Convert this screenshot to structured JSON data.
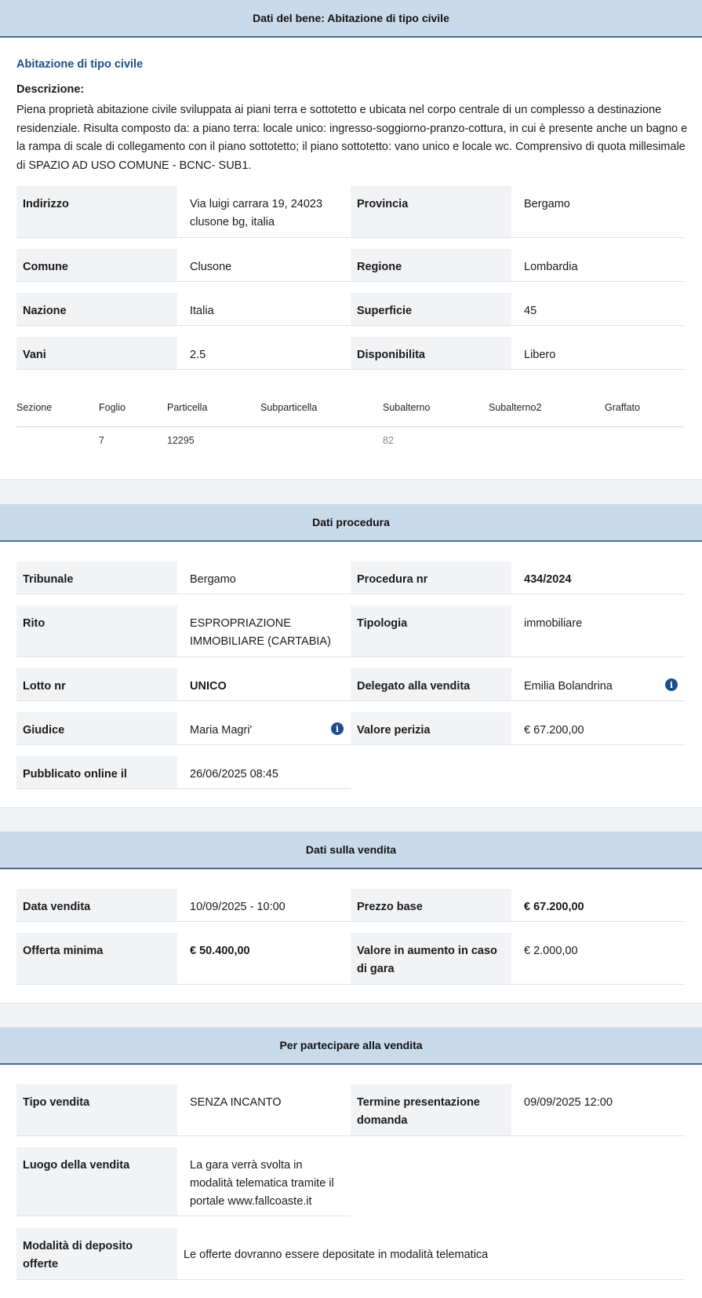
{
  "sections": {
    "bene": "Dati del bene: Abitazione di tipo civile",
    "procedura": "Dati procedura",
    "vendita": "Dati sulla vendita",
    "partecipare": "Per partecipare alla vendita"
  },
  "bene": {
    "subtitle": "Abitazione di tipo civile",
    "desc_label": "Descrizione:",
    "description": "Piena proprietà abitazione civile sviluppata ai piani terra e sottotetto e ubicata nel corpo centrale di un complesso a destinazione residenziale. Risulta composto da: a piano terra: locale unico: ingresso-soggiorno-pranzo-cottura, in cui è presente anche un bagno e la rampa di scale di collegamento con il piano sottotetto; il piano sottotetto: vano unico e locale wc. Comprensivo di quota millesimale di SPAZIO AD USO COMUNE - BCNC- SUB1.",
    "indirizzo_l": "Indirizzo",
    "indirizzo_v": "Via luigi carrara 19, 24023 clusone bg, italia",
    "provincia_l": "Provincia",
    "provincia_v": "Bergamo",
    "comune_l": "Comune",
    "comune_v": "Clusone",
    "regione_l": "Regione",
    "regione_v": "Lombardia",
    "nazione_l": "Nazione",
    "nazione_v": "Italia",
    "superficie_l": "Superficie",
    "superficie_v": "45",
    "vani_l": "Vani",
    "vani_v": "2.5",
    "disponibilita_l": "Disponibilita",
    "disponibilita_v": "Libero"
  },
  "catasto": {
    "headers": [
      "Sezione",
      "Foglio",
      "Particella",
      "Subparticella",
      "Subalterno",
      "Subalterno2",
      "Graffato"
    ],
    "row": [
      "",
      "7",
      "12295",
      "",
      "82",
      "",
      ""
    ]
  },
  "procedura": {
    "tribunale_l": "Tribunale",
    "tribunale_v": "Bergamo",
    "procedura_l": "Procedura nr",
    "procedura_v": "434/2024",
    "rito_l": "Rito",
    "rito_v": "ESPROPRIAZIONE IMMOBILIARE (CARTABIA)",
    "tipologia_l": "Tipologia",
    "tipologia_v": "immobiliare",
    "lotto_l": "Lotto nr",
    "lotto_v": "UNICO",
    "delegato_l": "Delegato alla vendita",
    "delegato_v": "Emilia Bolandrina",
    "giudice_l": "Giudice",
    "giudice_v": "Maria Magri'",
    "perizia_l": "Valore perizia",
    "perizia_v": "€ 67.200,00",
    "pubblicato_l": "Pubblicato online il",
    "pubblicato_v": "26/06/2025 08:45"
  },
  "vendita": {
    "data_l": "Data vendita",
    "data_v": "10/09/2025 - 10:00",
    "prezzo_l": "Prezzo base",
    "prezzo_v": "€ 67.200,00",
    "offerta_l": "Offerta minima",
    "offerta_v": "€ 50.400,00",
    "aumento_l": "Valore in aumento in caso di gara",
    "aumento_v": "€ 2.000,00"
  },
  "partecipare": {
    "tipo_l": "Tipo vendita",
    "tipo_v": "SENZA INCANTO",
    "termine_l": "Termine presentazione domanda",
    "termine_v": "09/09/2025 12:00",
    "luogo_l": "Luogo della vendita",
    "luogo_v": "La gara verrà svolta in modalità telematica tramite il portale www.fallcoaste.it",
    "deposito_l": "Modalità di deposito offerte",
    "deposito_v": "Le offerte dovranno essere depositate in modalità telematica"
  },
  "icons": {
    "info": "info-icon",
    "info_glyph": "i"
  },
  "colors": {
    "header_bg": "#c9daeb",
    "accent": "#1d4e8c"
  }
}
